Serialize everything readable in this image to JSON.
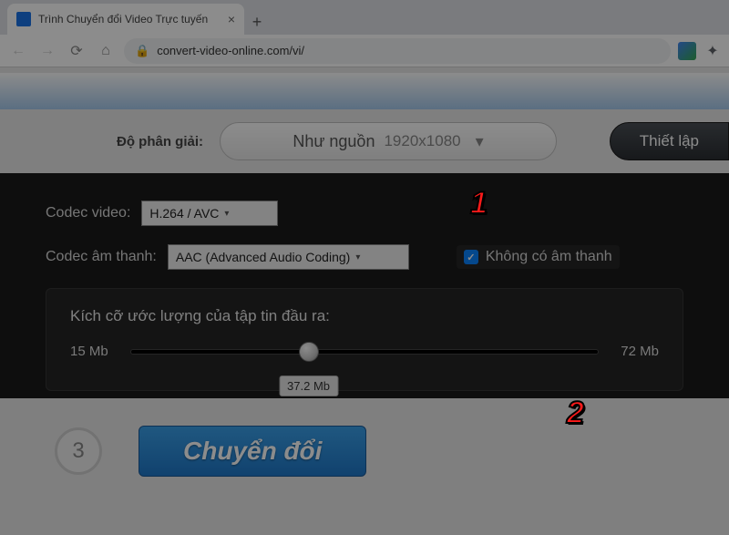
{
  "browser": {
    "tab_title": "Trình Chuyển đổi Video Trực tuyến",
    "url": "convert-video-online.com/vi/"
  },
  "toolbar": {
    "resolution_label": "Độ phân giải:",
    "resolution_mode": "Như nguồn",
    "resolution_value": "1920x1080",
    "settings_label": "Thiết lập"
  },
  "options": {
    "video_codec_label": "Codec video:",
    "video_codec_value": "H.264 / AVC",
    "audio_codec_label": "Codec âm thanh:",
    "audio_codec_value": "AAC (Advanced Audio Coding)",
    "no_audio_label": "Không có âm thanh"
  },
  "size": {
    "label": "Kích cỡ ước lượng của tập tin đầu ra:",
    "min": "15 Mb",
    "max": "72 Mb",
    "value": "37.2 Mb"
  },
  "step": {
    "number": "3",
    "convert_label": "Chuyển đổi"
  },
  "callouts": {
    "one": "1",
    "two": "2"
  }
}
